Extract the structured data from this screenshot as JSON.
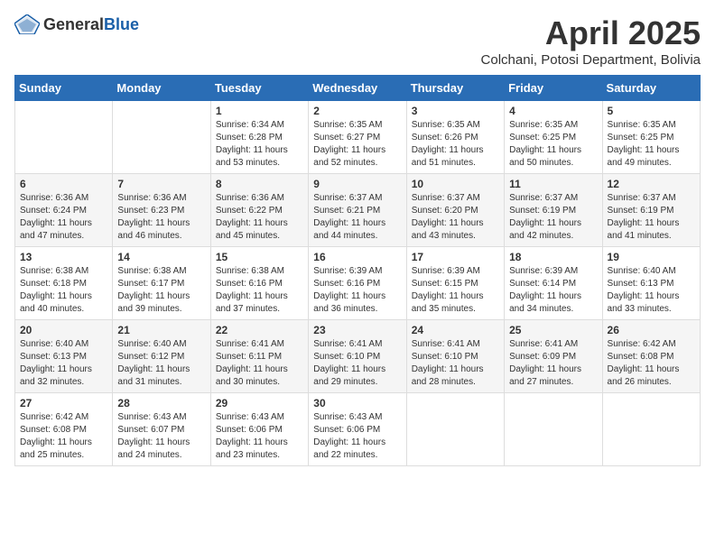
{
  "header": {
    "logo_general": "General",
    "logo_blue": "Blue",
    "month": "April 2025",
    "location": "Colchani, Potosi Department, Bolivia"
  },
  "weekdays": [
    "Sunday",
    "Monday",
    "Tuesday",
    "Wednesday",
    "Thursday",
    "Friday",
    "Saturday"
  ],
  "weeks": [
    [
      {
        "day": "",
        "info": ""
      },
      {
        "day": "",
        "info": ""
      },
      {
        "day": "1",
        "info": "Sunrise: 6:34 AM\nSunset: 6:28 PM\nDaylight: 11 hours and 53 minutes."
      },
      {
        "day": "2",
        "info": "Sunrise: 6:35 AM\nSunset: 6:27 PM\nDaylight: 11 hours and 52 minutes."
      },
      {
        "day": "3",
        "info": "Sunrise: 6:35 AM\nSunset: 6:26 PM\nDaylight: 11 hours and 51 minutes."
      },
      {
        "day": "4",
        "info": "Sunrise: 6:35 AM\nSunset: 6:25 PM\nDaylight: 11 hours and 50 minutes."
      },
      {
        "day": "5",
        "info": "Sunrise: 6:35 AM\nSunset: 6:25 PM\nDaylight: 11 hours and 49 minutes."
      }
    ],
    [
      {
        "day": "6",
        "info": "Sunrise: 6:36 AM\nSunset: 6:24 PM\nDaylight: 11 hours and 47 minutes."
      },
      {
        "day": "7",
        "info": "Sunrise: 6:36 AM\nSunset: 6:23 PM\nDaylight: 11 hours and 46 minutes."
      },
      {
        "day": "8",
        "info": "Sunrise: 6:36 AM\nSunset: 6:22 PM\nDaylight: 11 hours and 45 minutes."
      },
      {
        "day": "9",
        "info": "Sunrise: 6:37 AM\nSunset: 6:21 PM\nDaylight: 11 hours and 44 minutes."
      },
      {
        "day": "10",
        "info": "Sunrise: 6:37 AM\nSunset: 6:20 PM\nDaylight: 11 hours and 43 minutes."
      },
      {
        "day": "11",
        "info": "Sunrise: 6:37 AM\nSunset: 6:19 PM\nDaylight: 11 hours and 42 minutes."
      },
      {
        "day": "12",
        "info": "Sunrise: 6:37 AM\nSunset: 6:19 PM\nDaylight: 11 hours and 41 minutes."
      }
    ],
    [
      {
        "day": "13",
        "info": "Sunrise: 6:38 AM\nSunset: 6:18 PM\nDaylight: 11 hours and 40 minutes."
      },
      {
        "day": "14",
        "info": "Sunrise: 6:38 AM\nSunset: 6:17 PM\nDaylight: 11 hours and 39 minutes."
      },
      {
        "day": "15",
        "info": "Sunrise: 6:38 AM\nSunset: 6:16 PM\nDaylight: 11 hours and 37 minutes."
      },
      {
        "day": "16",
        "info": "Sunrise: 6:39 AM\nSunset: 6:16 PM\nDaylight: 11 hours and 36 minutes."
      },
      {
        "day": "17",
        "info": "Sunrise: 6:39 AM\nSunset: 6:15 PM\nDaylight: 11 hours and 35 minutes."
      },
      {
        "day": "18",
        "info": "Sunrise: 6:39 AM\nSunset: 6:14 PM\nDaylight: 11 hours and 34 minutes."
      },
      {
        "day": "19",
        "info": "Sunrise: 6:40 AM\nSunset: 6:13 PM\nDaylight: 11 hours and 33 minutes."
      }
    ],
    [
      {
        "day": "20",
        "info": "Sunrise: 6:40 AM\nSunset: 6:13 PM\nDaylight: 11 hours and 32 minutes."
      },
      {
        "day": "21",
        "info": "Sunrise: 6:40 AM\nSunset: 6:12 PM\nDaylight: 11 hours and 31 minutes."
      },
      {
        "day": "22",
        "info": "Sunrise: 6:41 AM\nSunset: 6:11 PM\nDaylight: 11 hours and 30 minutes."
      },
      {
        "day": "23",
        "info": "Sunrise: 6:41 AM\nSunset: 6:10 PM\nDaylight: 11 hours and 29 minutes."
      },
      {
        "day": "24",
        "info": "Sunrise: 6:41 AM\nSunset: 6:10 PM\nDaylight: 11 hours and 28 minutes."
      },
      {
        "day": "25",
        "info": "Sunrise: 6:41 AM\nSunset: 6:09 PM\nDaylight: 11 hours and 27 minutes."
      },
      {
        "day": "26",
        "info": "Sunrise: 6:42 AM\nSunset: 6:08 PM\nDaylight: 11 hours and 26 minutes."
      }
    ],
    [
      {
        "day": "27",
        "info": "Sunrise: 6:42 AM\nSunset: 6:08 PM\nDaylight: 11 hours and 25 minutes."
      },
      {
        "day": "28",
        "info": "Sunrise: 6:43 AM\nSunset: 6:07 PM\nDaylight: 11 hours and 24 minutes."
      },
      {
        "day": "29",
        "info": "Sunrise: 6:43 AM\nSunset: 6:06 PM\nDaylight: 11 hours and 23 minutes."
      },
      {
        "day": "30",
        "info": "Sunrise: 6:43 AM\nSunset: 6:06 PM\nDaylight: 11 hours and 22 minutes."
      },
      {
        "day": "",
        "info": ""
      },
      {
        "day": "",
        "info": ""
      },
      {
        "day": "",
        "info": ""
      }
    ]
  ]
}
